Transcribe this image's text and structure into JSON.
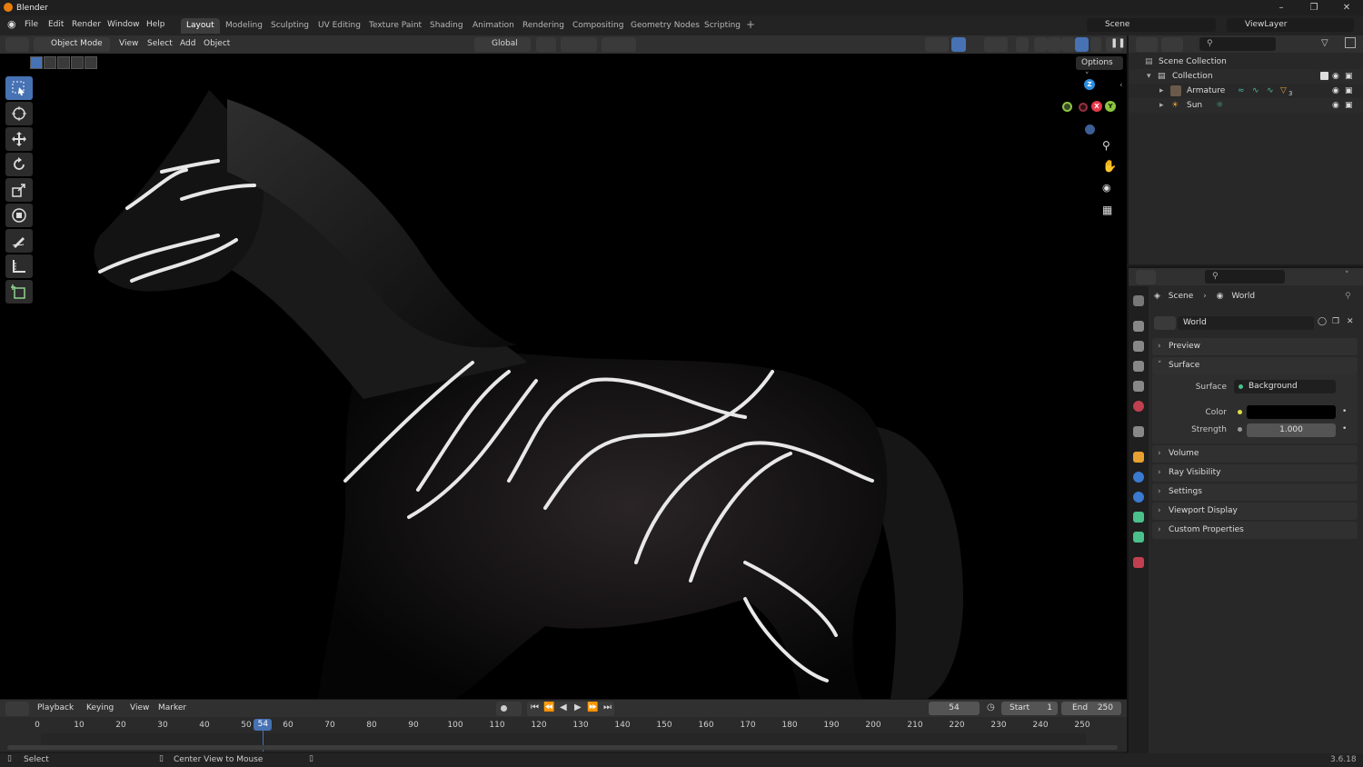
{
  "window": {
    "title": "Blender"
  },
  "menu": [
    "File",
    "Edit",
    "Render",
    "Window",
    "Help"
  ],
  "workspaces": [
    {
      "label": "Layout",
      "active": true
    },
    {
      "label": "Modeling"
    },
    {
      "label": "Sculpting"
    },
    {
      "label": "UV Editing"
    },
    {
      "label": "Texture Paint"
    },
    {
      "label": "Shading"
    },
    {
      "label": "Animation"
    },
    {
      "label": "Rendering"
    },
    {
      "label": "Compositing"
    },
    {
      "label": "Geometry Nodes"
    },
    {
      "label": "Scripting"
    }
  ],
  "add_workspace": "+",
  "scene_field": "Scene",
  "viewlayer_field": "ViewLayer",
  "viewport_header": {
    "mode": "Object Mode",
    "menus": [
      "View",
      "Select",
      "Add",
      "Object"
    ],
    "transform_orientation": "Global",
    "options_label": "Options"
  },
  "gizmo": {
    "z": "Z",
    "x": "X",
    "y": "Y"
  },
  "outliner": {
    "rows": [
      {
        "label": "Scene Collection",
        "icon": "collection-icon"
      },
      {
        "label": "Collection",
        "icon": "collection-icon"
      },
      {
        "label": "Armature",
        "icon": "armature-icon",
        "badge": "3"
      },
      {
        "label": "Sun",
        "icon": "sun-light-icon"
      }
    ]
  },
  "properties": {
    "breadcrumb": [
      "Scene",
      "World"
    ],
    "datablock": "World",
    "panels": [
      {
        "label": "Preview",
        "expanded": false
      },
      {
        "label": "Surface",
        "expanded": true
      },
      {
        "label": "Volume",
        "expanded": false
      },
      {
        "label": "Ray Visibility",
        "expanded": false
      },
      {
        "label": "Settings",
        "expanded": false
      },
      {
        "label": "Viewport Display",
        "expanded": false
      },
      {
        "label": "Custom Properties",
        "expanded": false
      }
    ],
    "surface": {
      "surface_label": "Surface",
      "surface_value": "Background",
      "color_label": "Color",
      "color_value": "#000000",
      "strength_label": "Strength",
      "strength_value": "1.000"
    }
  },
  "timeline": {
    "menus": [
      "Playback",
      "Keying",
      "View",
      "Marker"
    ],
    "current_frame": "54",
    "start_label": "Start",
    "start_value": "1",
    "end_label": "End",
    "end_value": "250",
    "ticks": [
      "0",
      "10",
      "20",
      "30",
      "40",
      "50",
      "60",
      "70",
      "80",
      "90",
      "100",
      "110",
      "120",
      "130",
      "140",
      "150",
      "160",
      "170",
      "180",
      "190",
      "200",
      "210",
      "220",
      "230",
      "240",
      "250"
    ]
  },
  "statusbar": {
    "left_hint": "Select",
    "middle_hint": "Center View to Mouse",
    "version": "3.6.18"
  },
  "colors": {
    "accent": "#4772b3",
    "blender_orange": "#e87d0d",
    "gizmo_x": "#e5394a",
    "gizmo_y": "#8cc63f",
    "gizmo_z": "#2a8fe0"
  }
}
